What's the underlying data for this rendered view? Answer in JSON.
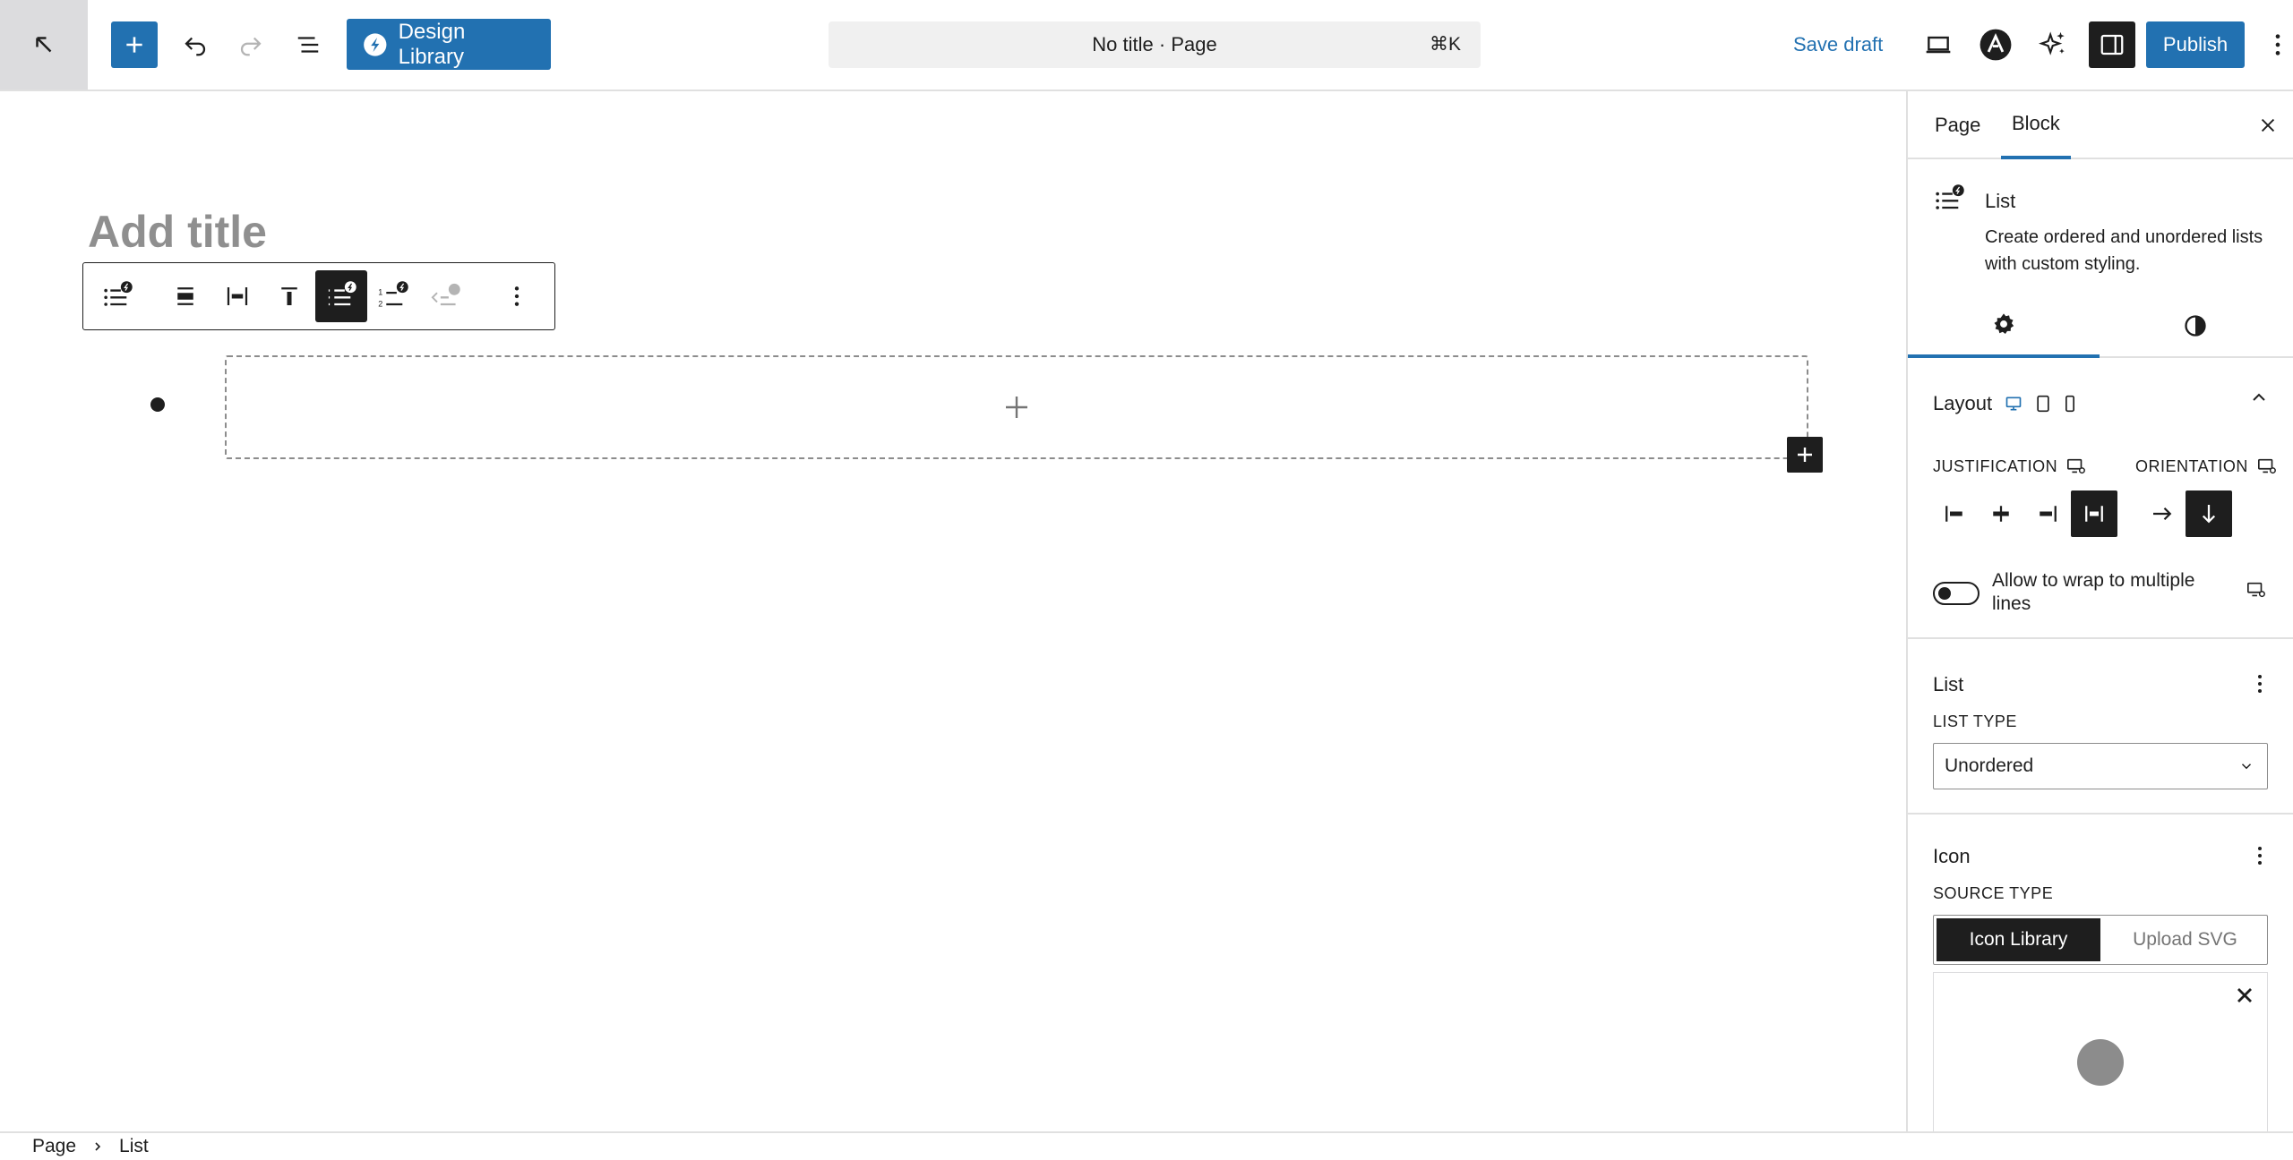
{
  "topbar": {
    "design_library_label": "Design Library",
    "doc_title": "No title · Page",
    "command_shortcut": "⌘K",
    "save_draft_label": "Save draft",
    "publish_label": "Publish"
  },
  "canvas": {
    "title_placeholder": "Add title"
  },
  "sidebar": {
    "tabs": [
      "Page",
      "Block"
    ],
    "active_tab": "Block",
    "block": {
      "name": "List",
      "description": "Create ordered and unordered lists with custom styling."
    },
    "layout_panel": {
      "title": "Layout",
      "justification_label": "JUSTIFICATION",
      "orientation_label": "ORIENTATION",
      "wrap_label": "Allow to wrap to multiple lines",
      "wrap_enabled": false
    },
    "list_panel": {
      "title": "List",
      "list_type_label": "LIST TYPE",
      "list_type_value": "Unordered"
    },
    "icon_panel": {
      "title": "Icon",
      "source_type_label": "SOURCE TYPE",
      "source_options": [
        "Icon Library",
        "Upload SVG"
      ],
      "selected_source": "Icon Library"
    }
  },
  "breadcrumb": {
    "items": [
      "Page",
      "List"
    ]
  },
  "colors": {
    "accent": "#2271b1",
    "dark": "#1e1e1e",
    "muted": "#8f8f8f"
  }
}
